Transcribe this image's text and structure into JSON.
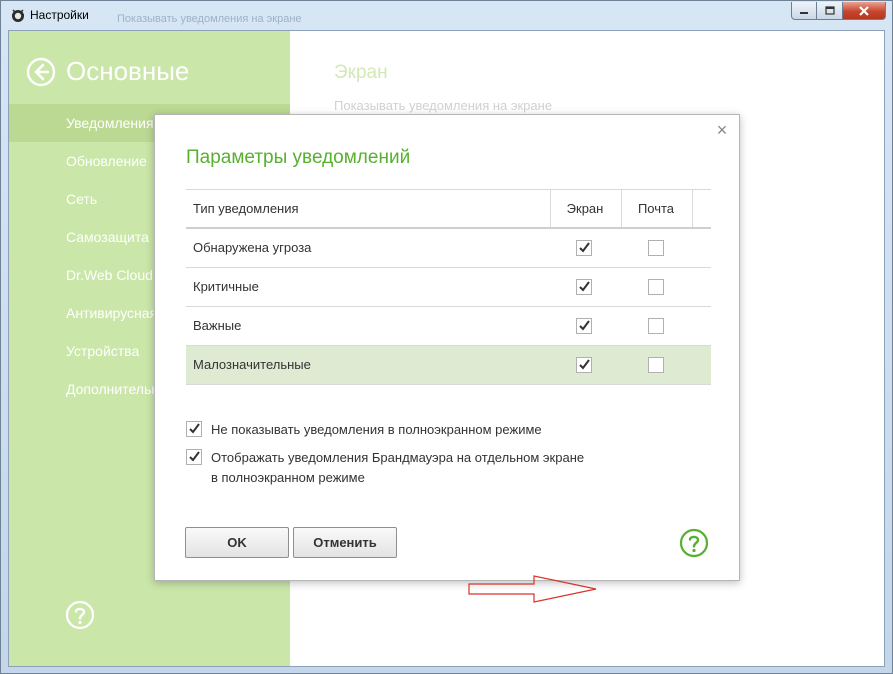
{
  "window": {
    "title": "Настройки",
    "ghost_text": "Показывать уведомления на экране"
  },
  "sidebar": {
    "title": "Основные",
    "items": [
      {
        "label": "Уведомления"
      },
      {
        "label": "Обновление"
      },
      {
        "label": "Сеть"
      },
      {
        "label": "Самозащита"
      },
      {
        "label": "Dr.Web Cloud"
      },
      {
        "label": "Антивирусная сеть"
      },
      {
        "label": "Устройства"
      },
      {
        "label": "Дополнительно"
      }
    ]
  },
  "main": {
    "title": "Экран",
    "subtitle": "Показывать уведомления на экране"
  },
  "dialog": {
    "title": "Параметры уведомлений",
    "close_glyph": "×",
    "columns": {
      "type": "Тип уведомления",
      "screen": "Экран",
      "mail": "Почта"
    },
    "rows": [
      {
        "label": "Обнаружена угроза",
        "screen": true,
        "mail": false
      },
      {
        "label": "Критичные",
        "screen": true,
        "mail": false
      },
      {
        "label": "Важные",
        "screen": true,
        "mail": false
      },
      {
        "label": "Малозначительные",
        "screen": true,
        "mail": false,
        "highlighted": true
      }
    ],
    "options": [
      {
        "label": "Не показывать уведомления в полноэкранном режиме",
        "checked": true
      },
      {
        "label": "Отображать уведомления Брандмауэра на отдельном экране в полноэкранном режиме",
        "checked": true
      }
    ],
    "ok_label": "OK",
    "cancel_label": "Отменить"
  },
  "colors": {
    "sidebar_bg": "#b9de8c",
    "sidebar_active": "#a5cd6f",
    "accent_green": "#58b030",
    "highlight_row": "#deebd2",
    "arrow": "#d9342b"
  },
  "icons": [
    "drweb-app-icon",
    "minimize-icon",
    "maximize-icon",
    "close-icon",
    "back-arrow-icon",
    "help-icon",
    "checkmark-icon",
    "red-arrow-annotation"
  ]
}
